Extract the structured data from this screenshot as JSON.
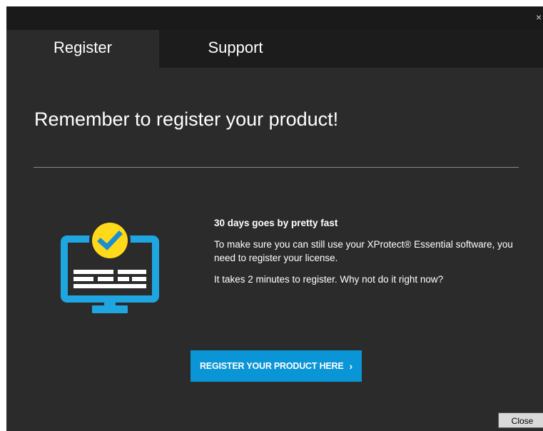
{
  "window": {
    "close_glyph": "×"
  },
  "tabs": [
    {
      "label": "Register",
      "active": true
    },
    {
      "label": "Support",
      "active": false
    }
  ],
  "main": {
    "headline": "Remember to register your product!",
    "info_title": "30 days goes by pretty fast",
    "info_body_1": "To make sure you can still use your XProtect® Essential software, you need to register your license.",
    "info_body_2": "It takes 2 minutes to register. Why not do it right now?",
    "register_button_label": "REGISTER YOUR PRODUCT HERE",
    "register_button_chevron": "›"
  },
  "footer": {
    "close_label": "Close"
  },
  "icons": {
    "illustration": "monitor-with-checkmark-icon",
    "checkmark": "checkmark-icon",
    "window_close": "close-icon"
  },
  "colors": {
    "background": "#2b2b2b",
    "tab_bar": "#1c1c1c",
    "accent_blue": "#0a95d6",
    "monitor_blue": "#1fa6e0",
    "check_yellow": "#ffd91a"
  }
}
